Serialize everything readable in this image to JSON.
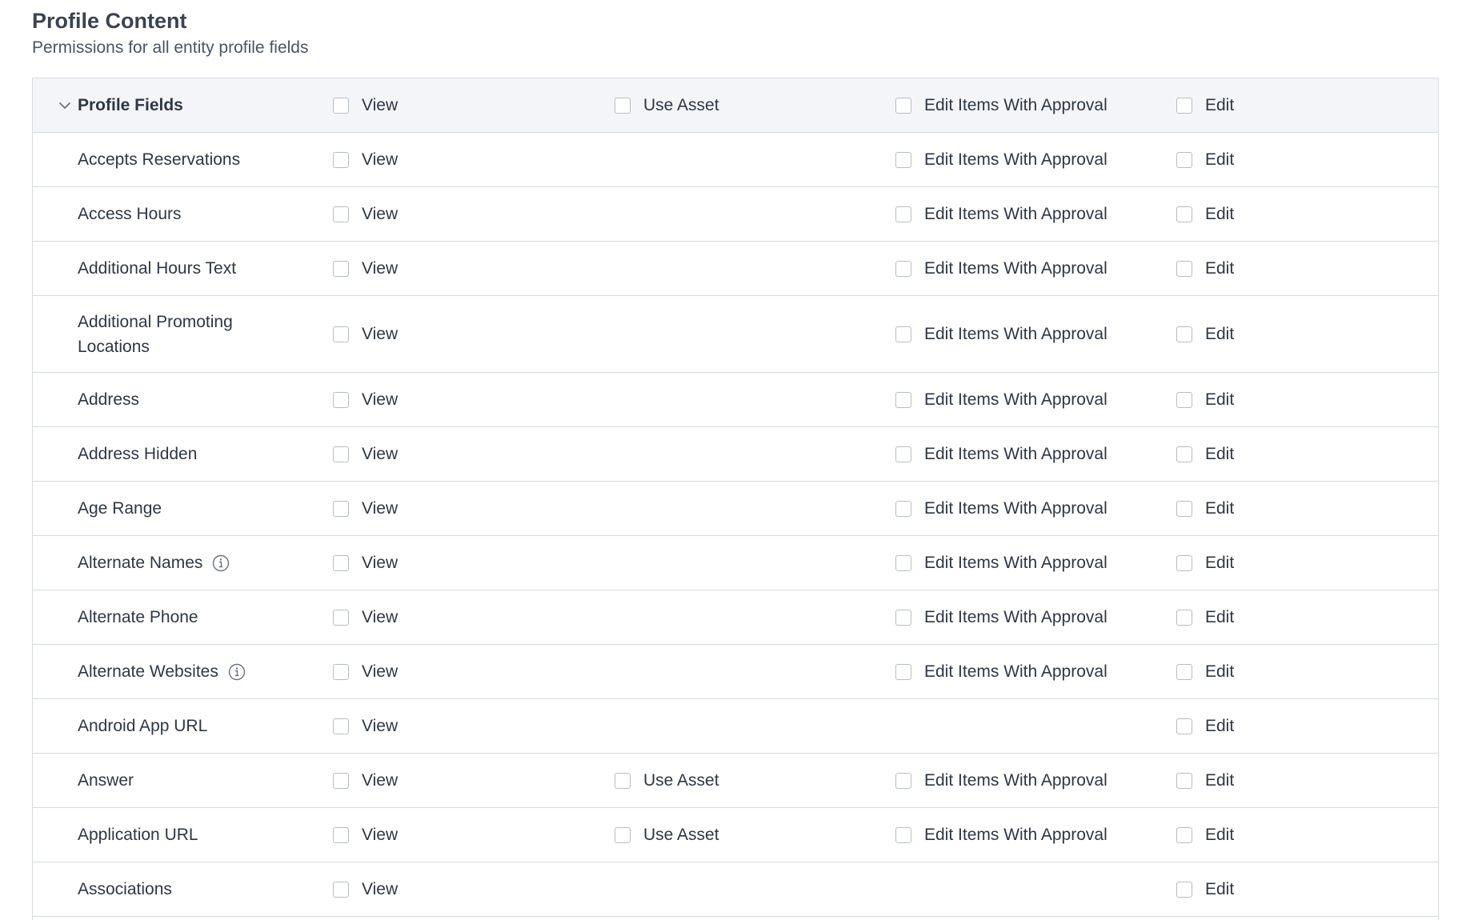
{
  "section": {
    "title": "Profile Content",
    "subtitle": "Permissions for all entity profile fields"
  },
  "header": {
    "name": "Profile Fields",
    "view_label": "View",
    "asset_label": "Use Asset",
    "approval_label": "Edit Items With Approval",
    "edit_label": "Edit"
  },
  "rows": [
    {
      "name": "Accepts Reservations",
      "view": "View",
      "asset": "",
      "approval": "Edit Items With Approval",
      "edit": "Edit",
      "info": false
    },
    {
      "name": "Access Hours",
      "view": "View",
      "asset": "",
      "approval": "Edit Items With Approval",
      "edit": "Edit",
      "info": false
    },
    {
      "name": "Additional Hours Text",
      "view": "View",
      "asset": "",
      "approval": "Edit Items With Approval",
      "edit": "Edit",
      "info": false
    },
    {
      "name": "Additional Promoting Locations",
      "view": "View",
      "asset": "",
      "approval": "Edit Items With Approval",
      "edit": "Edit",
      "info": false
    },
    {
      "name": "Address",
      "view": "View",
      "asset": "",
      "approval": "Edit Items With Approval",
      "edit": "Edit",
      "info": false
    },
    {
      "name": "Address Hidden",
      "view": "View",
      "asset": "",
      "approval": "Edit Items With Approval",
      "edit": "Edit",
      "info": false
    },
    {
      "name": "Age Range",
      "view": "View",
      "asset": "",
      "approval": "Edit Items With Approval",
      "edit": "Edit",
      "info": false
    },
    {
      "name": "Alternate Names",
      "view": "View",
      "asset": "",
      "approval": "Edit Items With Approval",
      "edit": "Edit",
      "info": true
    },
    {
      "name": "Alternate Phone",
      "view": "View",
      "asset": "",
      "approval": "Edit Items With Approval",
      "edit": "Edit",
      "info": false
    },
    {
      "name": "Alternate Websites",
      "view": "View",
      "asset": "",
      "approval": "Edit Items With Approval",
      "edit": "Edit",
      "info": true
    },
    {
      "name": "Android App URL",
      "view": "View",
      "asset": "",
      "approval": "",
      "edit": "Edit",
      "info": false
    },
    {
      "name": "Answer",
      "view": "View",
      "asset": "Use Asset",
      "approval": "Edit Items With Approval",
      "edit": "Edit",
      "info": false
    },
    {
      "name": "Application URL",
      "view": "View",
      "asset": "Use Asset",
      "approval": "Edit Items With Approval",
      "edit": "Edit",
      "info": false
    },
    {
      "name": "Associations",
      "view": "View",
      "asset": "",
      "approval": "",
      "edit": "Edit",
      "info": false
    }
  ],
  "icons": {
    "expand": "chevron-down-icon",
    "info": "info-icon"
  }
}
